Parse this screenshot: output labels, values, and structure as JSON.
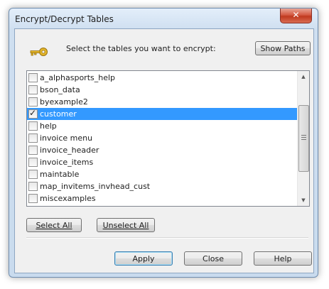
{
  "window": {
    "title": "Encrypt/Decrypt Tables",
    "close_label": "✕"
  },
  "prompt": "Select the tables you want to encrypt:",
  "buttons": {
    "show_paths": "Show Paths",
    "select_all": "Select All",
    "unselect_all": "Unselect All",
    "apply": "Apply",
    "close": "Close",
    "help": "Help"
  },
  "tables": [
    {
      "name": "a_alphasports_help",
      "checked": false,
      "selected": false
    },
    {
      "name": "bson_data",
      "checked": false,
      "selected": false
    },
    {
      "name": "byexample2",
      "checked": false,
      "selected": false
    },
    {
      "name": "customer",
      "checked": true,
      "selected": true
    },
    {
      "name": "help",
      "checked": false,
      "selected": false
    },
    {
      "name": "invoice menu",
      "checked": false,
      "selected": false
    },
    {
      "name": "invoice_header",
      "checked": false,
      "selected": false
    },
    {
      "name": "invoice_items",
      "checked": false,
      "selected": false
    },
    {
      "name": "maintable",
      "checked": false,
      "selected": false
    },
    {
      "name": "map_invitems_invhead_cust",
      "checked": false,
      "selected": false
    },
    {
      "name": "miscexamples",
      "checked": false,
      "selected": false
    }
  ],
  "icons": {
    "key": "key-icon",
    "scroll_up": "chevron-up-icon",
    "scroll_down": "chevron-down-icon"
  },
  "colors": {
    "selection": "#3399ff",
    "title_bar": "#cfdff0",
    "close_button": "#c0391f",
    "key": "#d9a521"
  }
}
